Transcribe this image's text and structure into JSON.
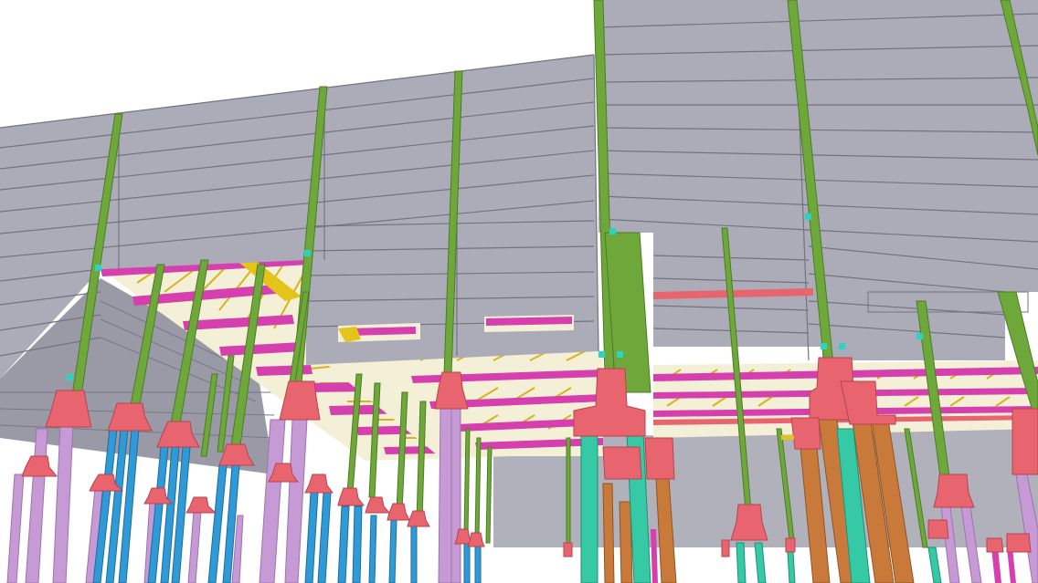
{
  "scene": {
    "subject": "3d-structural-model-shoring-falsework",
    "colors": {
      "sky": "#ffffff",
      "slab": "#a9a9b5",
      "slab_line": "#6f6f7c",
      "slab_side": "#9c9ca8",
      "green_post": "#6fa83a",
      "magenta_beam": "#d63fae",
      "yellow_joist": "#e3c419",
      "red_head": "#e8646e",
      "blue_shore": "#2f9ad6",
      "purple_shore": "#c69ad4",
      "orange_shore": "#c97a3a",
      "teal_shore": "#35c9a6",
      "cyan_node": "#2bd3c0"
    }
  }
}
